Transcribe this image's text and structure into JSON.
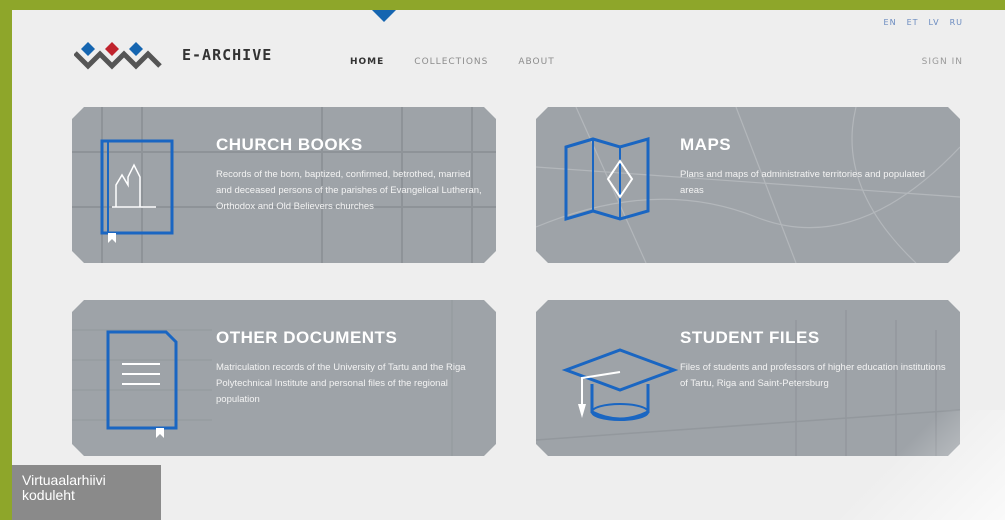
{
  "header": {
    "brand": "E-ARCHIVE",
    "languages": [
      "EN",
      "ET",
      "LV",
      "RU"
    ],
    "nav": [
      "HOME",
      "COLLECTIONS",
      "ABOUT"
    ],
    "sign_in": "SIGN IN"
  },
  "cards": [
    {
      "title": "CHURCH BOOKS",
      "description": "Records of the born, baptized, confirmed, betrothed, married and deceased persons of the parishes of Evangelical Lutheran, Orthodox and Old Believers churches",
      "icon": "church-book-icon"
    },
    {
      "title": "MAPS",
      "description": "Plans and maps of administrative territories and populated areas",
      "icon": "folded-map-icon"
    },
    {
      "title": "OTHER DOCUMENTS",
      "description": "Matriculation records of the University of Tartu and the Riga Polytechnical Institute and personal files of the regional population",
      "icon": "document-icon"
    },
    {
      "title": "STUDENT FILES",
      "description": "Files of students and professors of higher education institutions of Tartu, Riga and Saint-Petersburg",
      "icon": "graduation-cap-icon"
    }
  ],
  "caption": "Virtuaalarhiivi koduleht",
  "colors": {
    "outer_background": "#8ea62a",
    "page_background": "#eeeeee",
    "accent_blue": "#1565b0",
    "accent_red": "#c0232d",
    "card_background": "#9ea3a8"
  }
}
